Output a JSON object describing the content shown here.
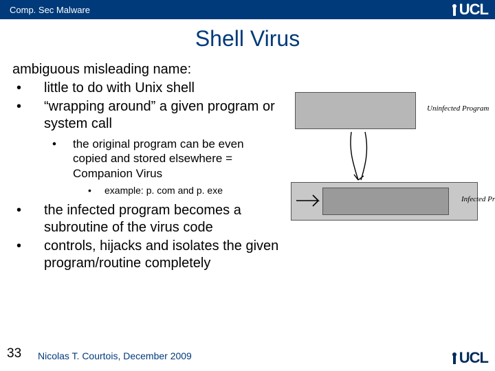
{
  "header": {
    "breadcrumb": "Comp. Sec Malware"
  },
  "title": "Shell Virus",
  "lead": "ambiguous misleading name:",
  "bullets": {
    "b1": "little to do with Unix shell",
    "b2": "“wrapping around” a given program or system call",
    "sub1": "the original program can be even copied and stored elsewhere = Companion Virus",
    "sub1ex": "example: p. com and p. exe",
    "b3": "the infected program becomes a subroutine of the virus code",
    "b4": "controls, hijacks and isolates the given program/routine completely"
  },
  "diagram": {
    "label_uninfected": "Uninfected Program",
    "label_infected": "Infected Program"
  },
  "footer": {
    "page": "33",
    "author": "Nicolas T. Courtois, December 2009"
  },
  "logo": "UCL"
}
